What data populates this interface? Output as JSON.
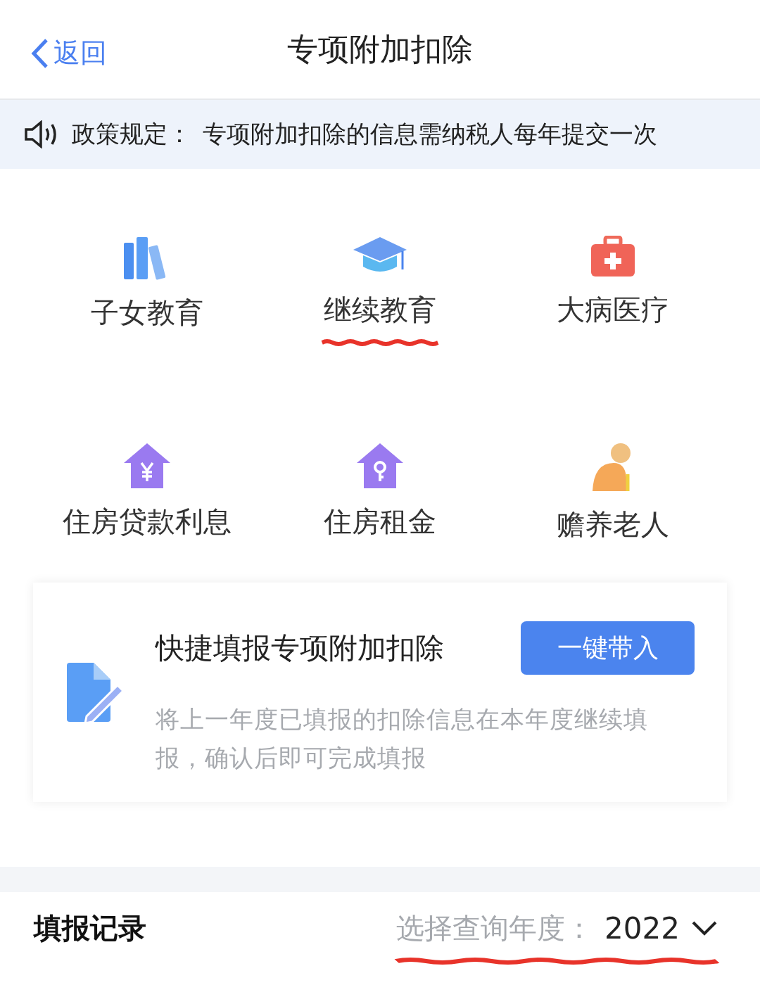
{
  "header": {
    "back_label": "返回",
    "title": "专项附加扣除"
  },
  "notice": {
    "label": "政策规定：",
    "text": "专项附加扣除的信息需纳税人每年提交一次"
  },
  "categories": [
    {
      "kind": "books",
      "label": "子女教育",
      "annotated": false
    },
    {
      "kind": "cap",
      "label": "继续教育",
      "annotated": true
    },
    {
      "kind": "medkit",
      "label": "大病医疗",
      "annotated": false
    },
    {
      "kind": "house-yuan",
      "label": "住房贷款利息",
      "annotated": false
    },
    {
      "kind": "house-key",
      "label": "住房租金",
      "annotated": false
    },
    {
      "kind": "elder",
      "label": "赡养老人",
      "annotated": false
    }
  ],
  "quick_fill": {
    "title": "快捷填报专项附加扣除",
    "button": "一键带入",
    "description": "将上一年度已填报的扣除信息在本年度继续填报，确认后即可完成填报"
  },
  "records": {
    "title": "填报记录",
    "year_label": "选择查询年度：",
    "year": "2022",
    "annotated": true
  }
}
